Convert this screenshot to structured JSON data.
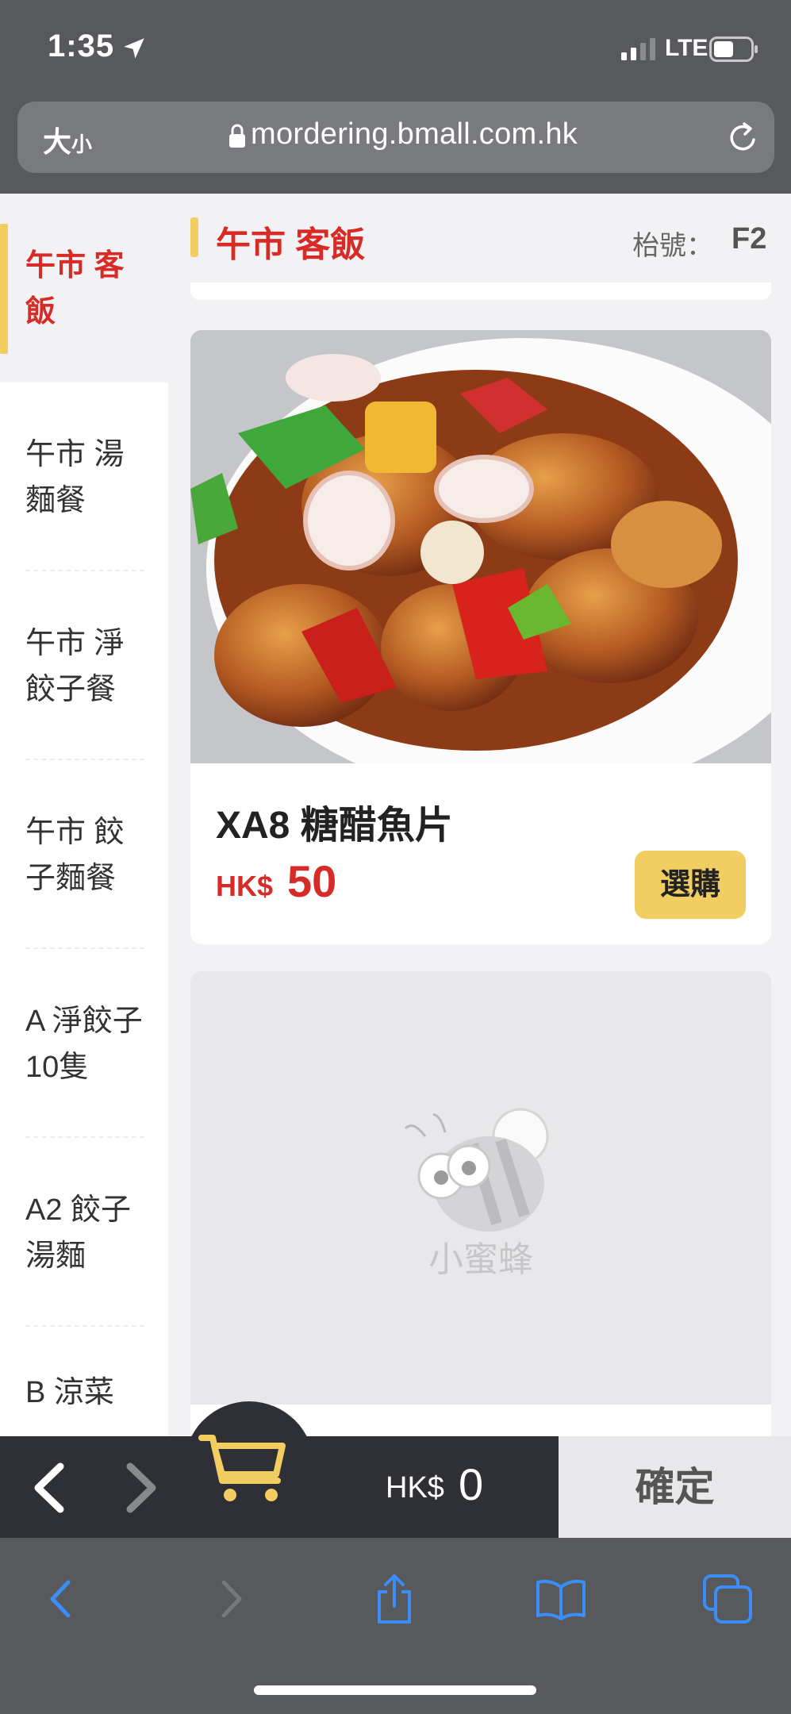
{
  "status_bar": {
    "time": "1:35",
    "network": "LTE"
  },
  "browser": {
    "text_size_big": "大",
    "text_size_small": "小",
    "url": "mordering.bmall.com.hk"
  },
  "sidebar": {
    "items": [
      {
        "label": "午市 客飯",
        "active": true
      },
      {
        "label": "午市 湯麵餐",
        "active": false
      },
      {
        "label": "午市 淨餃子餐",
        "active": false
      },
      {
        "label": "午市 餃子麵餐",
        "active": false
      },
      {
        "label": "A 淨餃子10隻",
        "active": false
      },
      {
        "label": "A2 餃子湯麵",
        "active": false
      },
      {
        "label": "B 涼菜",
        "active": false
      }
    ]
  },
  "header": {
    "category": "午市 客飯",
    "table_label": "枱號：",
    "table_number": "F2"
  },
  "product": {
    "name": "XA8 糖醋魚片",
    "currency": "HK$",
    "price": "50",
    "buy_label": "選購"
  },
  "placeholder": {
    "brand_text": "小蜜蜂"
  },
  "cart": {
    "currency": "HK$",
    "total": "0",
    "confirm_label": "確定"
  },
  "colors": {
    "accent_red": "#d62b26",
    "accent_yellow": "#f2cd61",
    "safari_blue": "#3a8ef6",
    "cart_bar": "#2f3035"
  },
  "icons": [
    "location-arrow-icon",
    "signal-icon",
    "battery-icon",
    "lock-icon",
    "reload-icon",
    "chevron-left-icon",
    "chevron-right-icon",
    "cart-icon",
    "share-icon",
    "bookmarks-icon",
    "tabs-icon"
  ]
}
